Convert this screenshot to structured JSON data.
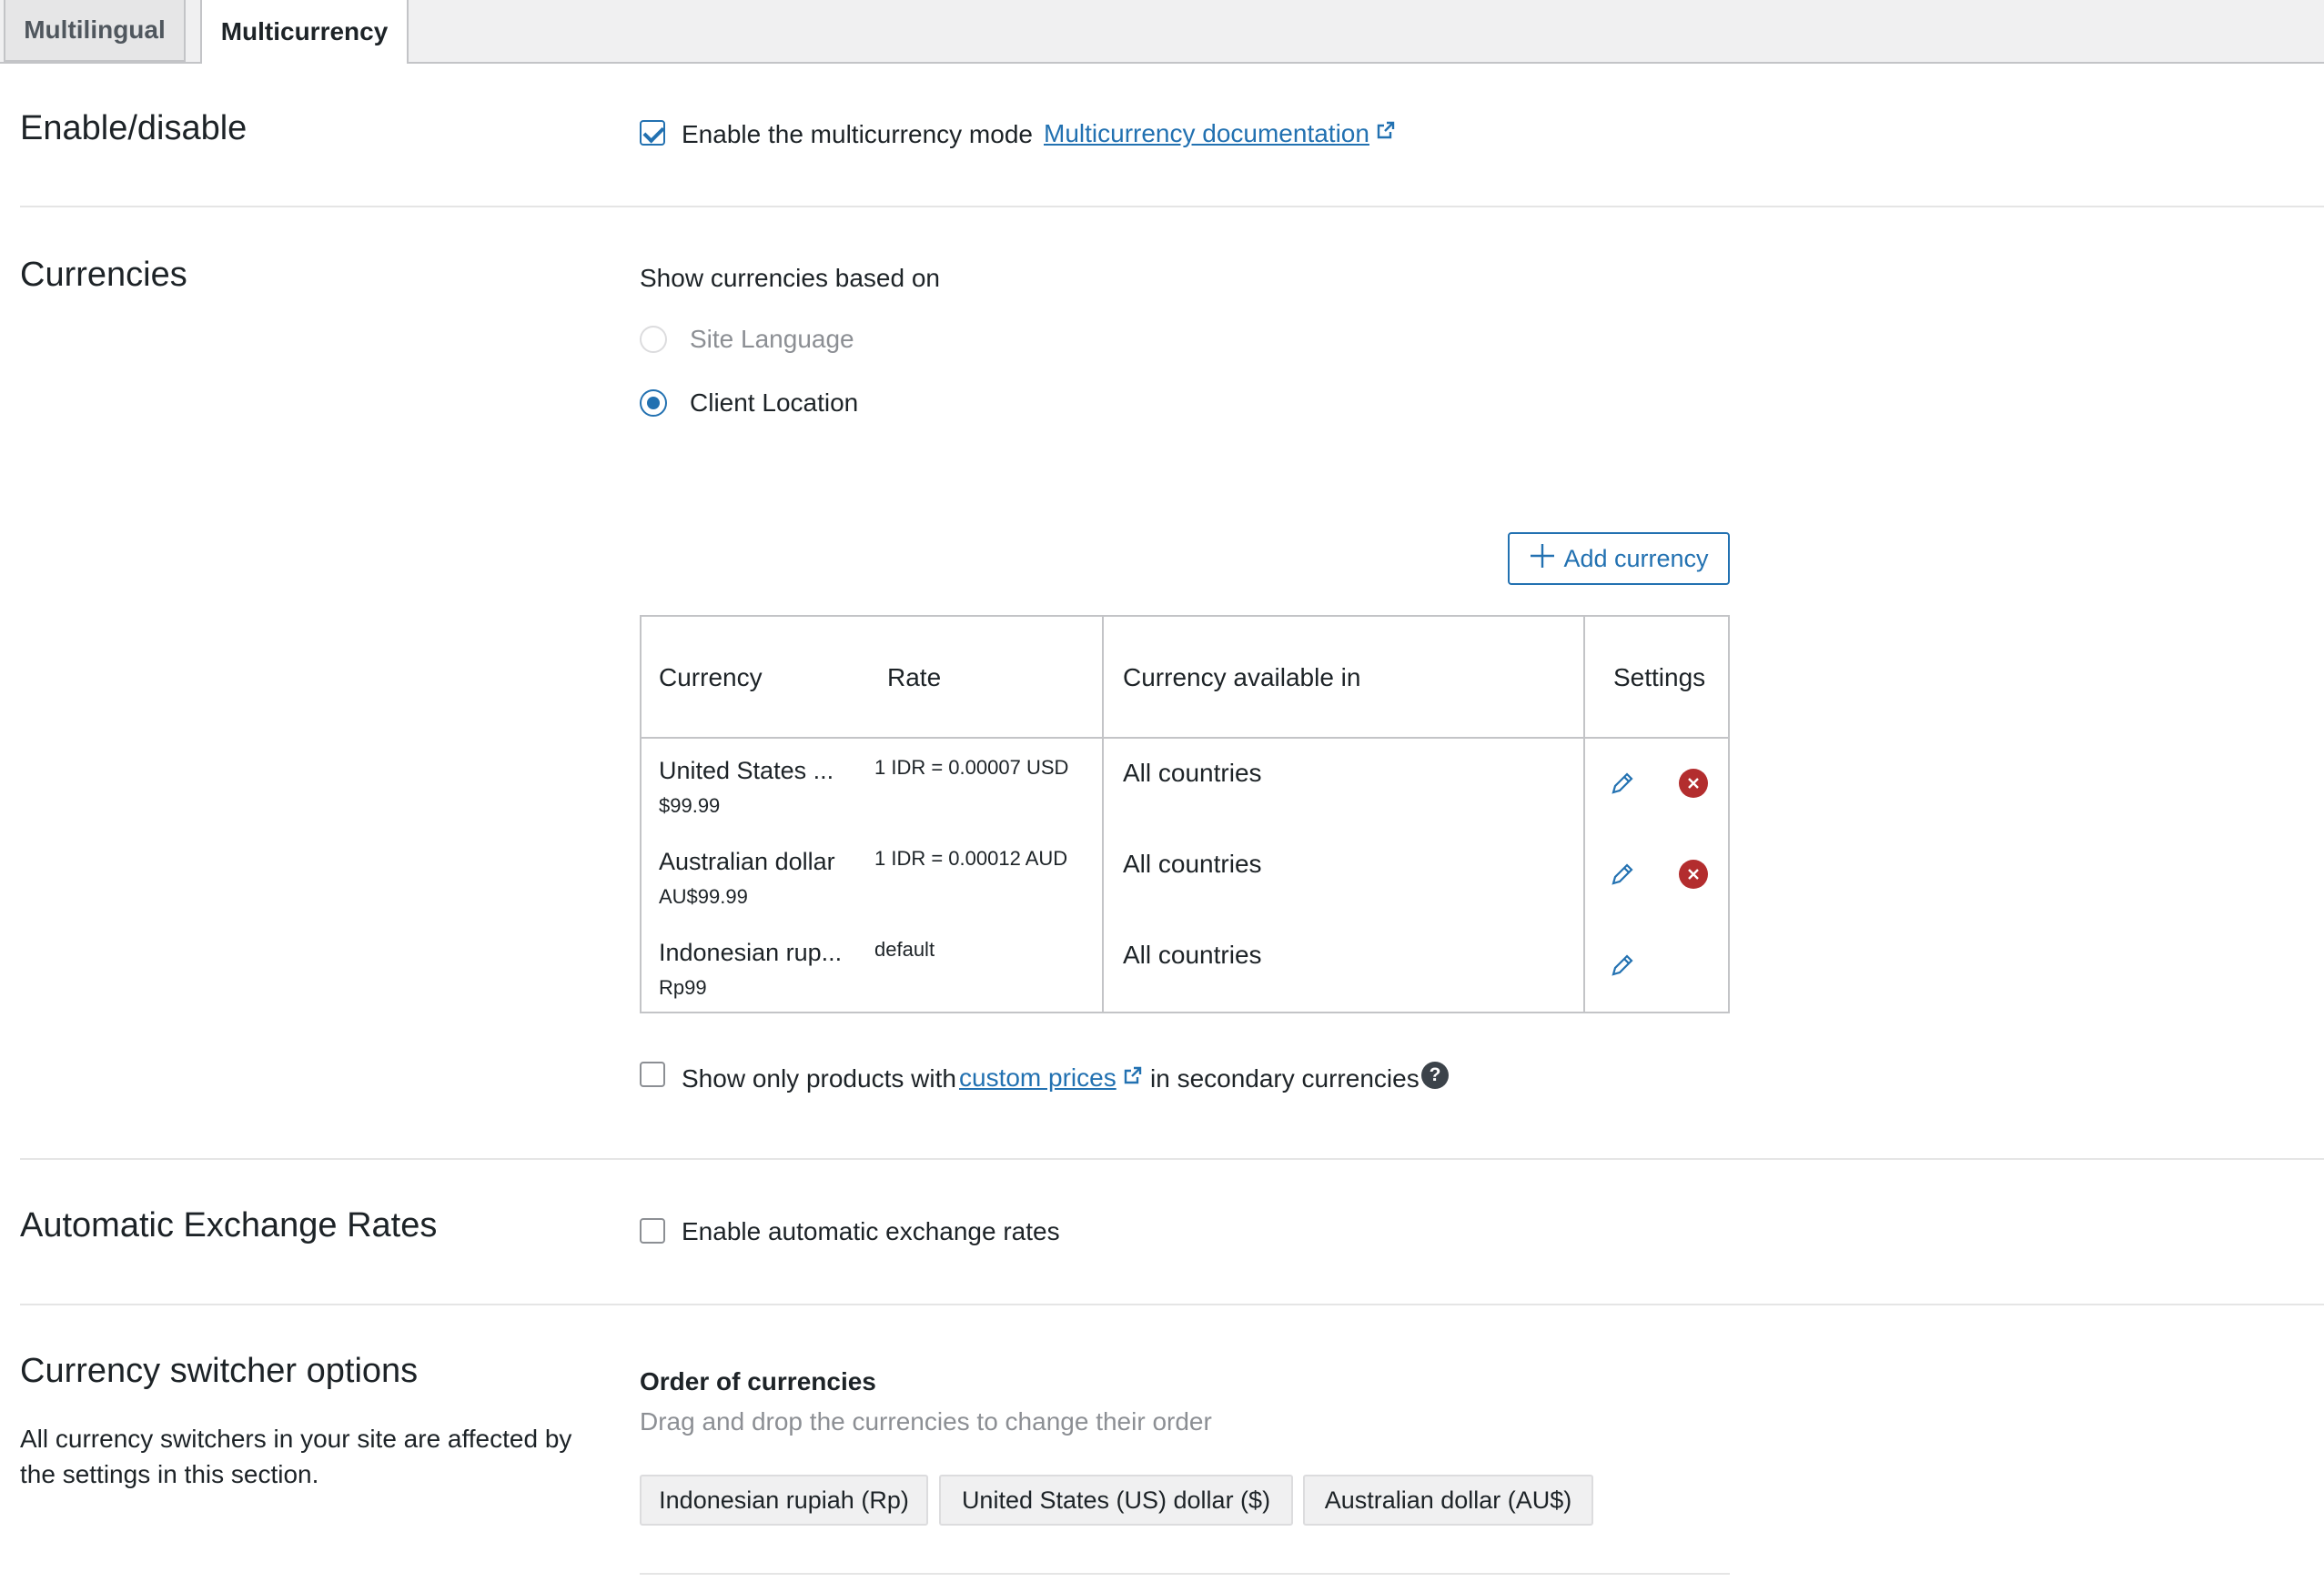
{
  "tabs": [
    {
      "label": "Multilingual",
      "active": false
    },
    {
      "label": "Multicurrency",
      "active": true
    }
  ],
  "enable_section": {
    "title": "Enable/disable",
    "checkbox_label": "Enable the multicurrency mode",
    "checked": true,
    "doc_link": "Multicurrency documentation"
  },
  "currencies_section": {
    "title": "Currencies",
    "show_based_on_label": "Show currencies based on",
    "options": [
      {
        "label": "Site Language",
        "selected": false,
        "disabled": true
      },
      {
        "label": "Client Location",
        "selected": true,
        "disabled": false
      }
    ],
    "add_button": "Add currency",
    "table": {
      "headers": {
        "currency": "Currency",
        "rate": "Rate",
        "available": "Currency available in",
        "settings": "Settings"
      },
      "rows": [
        {
          "name": "United States ...",
          "price": "$99.99",
          "rate": "1 IDR = 0.00007 USD",
          "available": "All countries",
          "deletable": true
        },
        {
          "name": "Australian dollar",
          "price": "AU$99.99",
          "rate": "1 IDR = 0.00012 AUD",
          "available": "All countries",
          "deletable": true
        },
        {
          "name": "Indonesian rup...",
          "price": "Rp99",
          "rate": "default",
          "available": "All countries",
          "deletable": false
        }
      ]
    },
    "custom_prices": {
      "before": "Show only products with",
      "link": "custom prices",
      "after": "in secondary currencies",
      "checked": false,
      "help": "?"
    }
  },
  "exchange_section": {
    "title": "Automatic Exchange Rates",
    "checkbox_label": "Enable automatic exchange rates",
    "checked": false
  },
  "switcher_section": {
    "title": "Currency switcher options",
    "description_line1": "All currency switchers in your site are affected by",
    "description_line2": "the settings in this section.",
    "order_title": "Order of currencies",
    "order_hint": "Drag and drop the currencies to change their order",
    "order": [
      "Indonesian rupiah (Rp)",
      "United States (US) dollar ($)",
      "Australian dollar (AU$)"
    ]
  },
  "colors": {
    "accent": "#2271b1",
    "delete": "#b32d2e",
    "border": "#c3c4c7",
    "muted": "#8c8f94"
  },
  "icons": {
    "edit": "pencil-icon",
    "delete": "close-circle-icon",
    "external": "external-link-icon",
    "add": "plus-icon",
    "help": "question-icon"
  }
}
